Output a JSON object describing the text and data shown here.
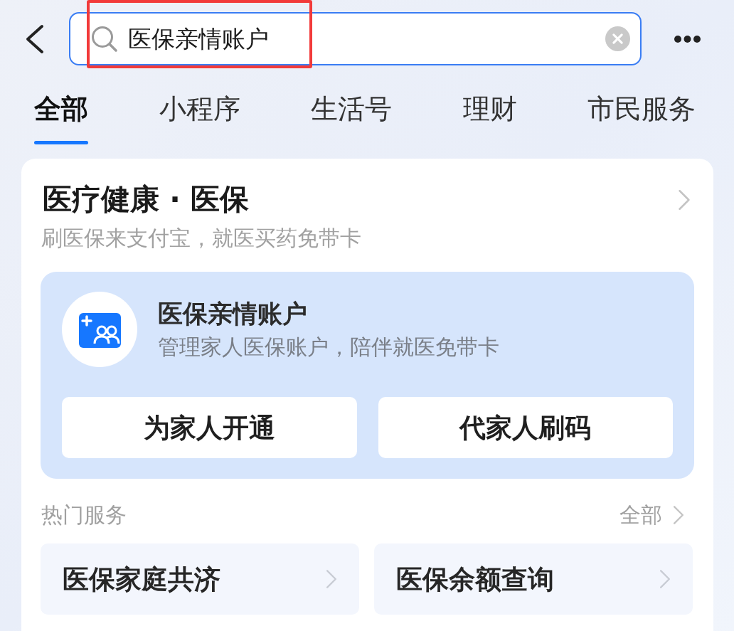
{
  "search": {
    "value": "医保亲情账户"
  },
  "tabs": [
    {
      "label": "全部",
      "selected": true
    },
    {
      "label": "小程序",
      "selected": false
    },
    {
      "label": "生活号",
      "selected": false
    },
    {
      "label": "理财",
      "selected": false
    },
    {
      "label": "市民服务",
      "selected": false
    }
  ],
  "card": {
    "title": "医疗健康 · 医保",
    "subtitle": "刷医保来支付宝，就医买药免带卡",
    "feature": {
      "title": "医保亲情账户",
      "description": "管理家人医保账户，陪伴就医免带卡",
      "buttons": [
        "为家人开通",
        "代家人刷码"
      ]
    },
    "hot_services": {
      "title": "热门服务",
      "more": "全部",
      "items": [
        "医保家庭共济",
        "医保余额查询"
      ]
    }
  }
}
